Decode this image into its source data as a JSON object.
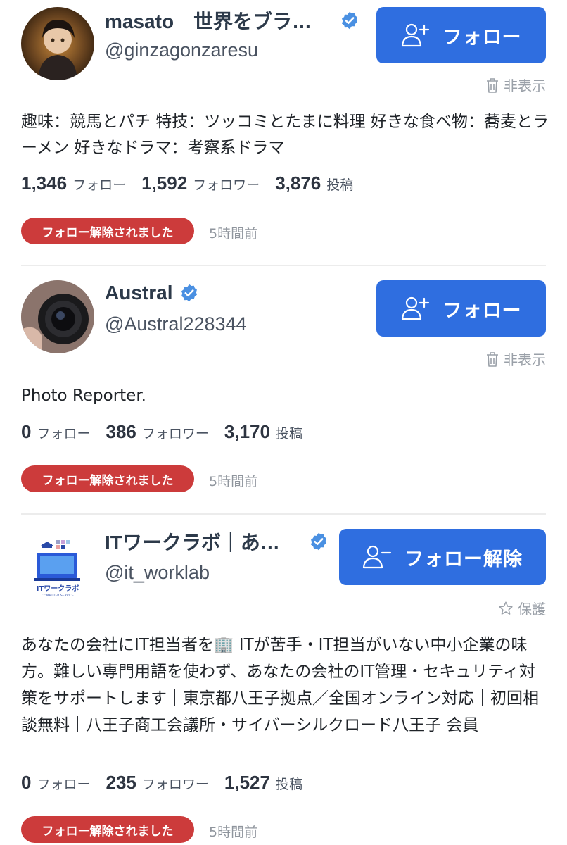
{
  "users": [
    {
      "name": "masato　世界をブラッ…",
      "handle": "@ginzagonzaresu",
      "button_label": "フォロー",
      "sub_action": "非表示",
      "bio": "趣味：競馬とパチ 特技：ツッコミとたまに料理 好きな食べ物：蕎麦とラーメン 好きなドラマ：考察系ドラマ",
      "following": "1,346",
      "following_label": "フォロー",
      "followers": "1,592",
      "followers_label": "フォロワー",
      "posts": "3,876",
      "posts_label": "投稿",
      "status": "フォロー解除されました",
      "time": "5時間前"
    },
    {
      "name": "Austral",
      "handle": "@Austral228344",
      "button_label": "フォロー",
      "sub_action": "非表示",
      "bio": "Photo Reporter.",
      "following": "0",
      "following_label": "フォロー",
      "followers": "386",
      "followers_label": "フォロワー",
      "posts": "3,170",
      "posts_label": "投稿",
      "status": "フォロー解除されました",
      "time": "5時間前"
    },
    {
      "name": "ITワークラボ｜あな…",
      "handle": "@it_worklab",
      "button_label": "フォロー解除",
      "sub_action": "保護",
      "bio": "あなたの会社にIT担当者を🏢 ITが苦手・IT担当がいない中小企業の味方。難しい専門用語を使わず、あなたの会社のIT管理・セキュリティ対策をサポートします｜東京都八王子拠点／全国オンライン対応｜初回相談無料｜八王子商工会議所・サイバーシルクロード八王子 会員",
      "logo_text": "ITワークラボ",
      "logo_subtext": "COMPUTER SERVICE",
      "following": "0",
      "following_label": "フォロー",
      "followers": "235",
      "followers_label": "フォロワー",
      "posts": "1,527",
      "posts_label": "投稿",
      "status": "フォロー解除されました",
      "time": "5時間前"
    }
  ],
  "colors": {
    "primary_button": "#2f6ee0",
    "unfollow_badge": "#cc3b3b",
    "verified_badge": "#4a90e2"
  },
  "icons": {
    "verified": "verified-badge-icon",
    "follow": "person-add-icon",
    "unfollow": "person-remove-icon",
    "hide": "trash-icon",
    "protect": "star-outline-icon"
  }
}
